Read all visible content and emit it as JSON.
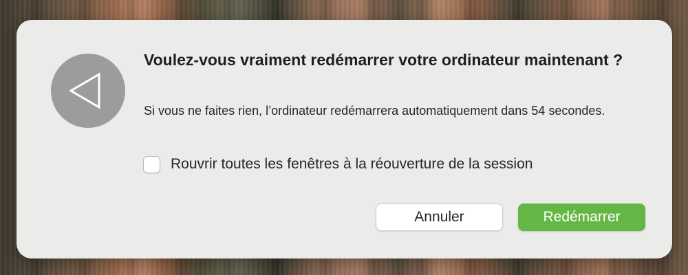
{
  "dialog": {
    "icon": "restart-arrow-icon",
    "title": "Voulez-vous vraiment redémarrer votre ordinateur maintenant ?",
    "message": "Si vous ne faites rien, l’ordinateur redémarrera automatiquement dans 54 secondes.",
    "checkbox": {
      "label": "Rouvrir toutes les fenêtres à la réouverture de la session",
      "checked": false
    },
    "buttons": {
      "cancel_label": "Annuler",
      "restart_label": "Redémarrer"
    }
  },
  "colors": {
    "dialog_background": "#ebebea",
    "icon_background": "#9c9c9c",
    "primary_button": "#65b745"
  }
}
